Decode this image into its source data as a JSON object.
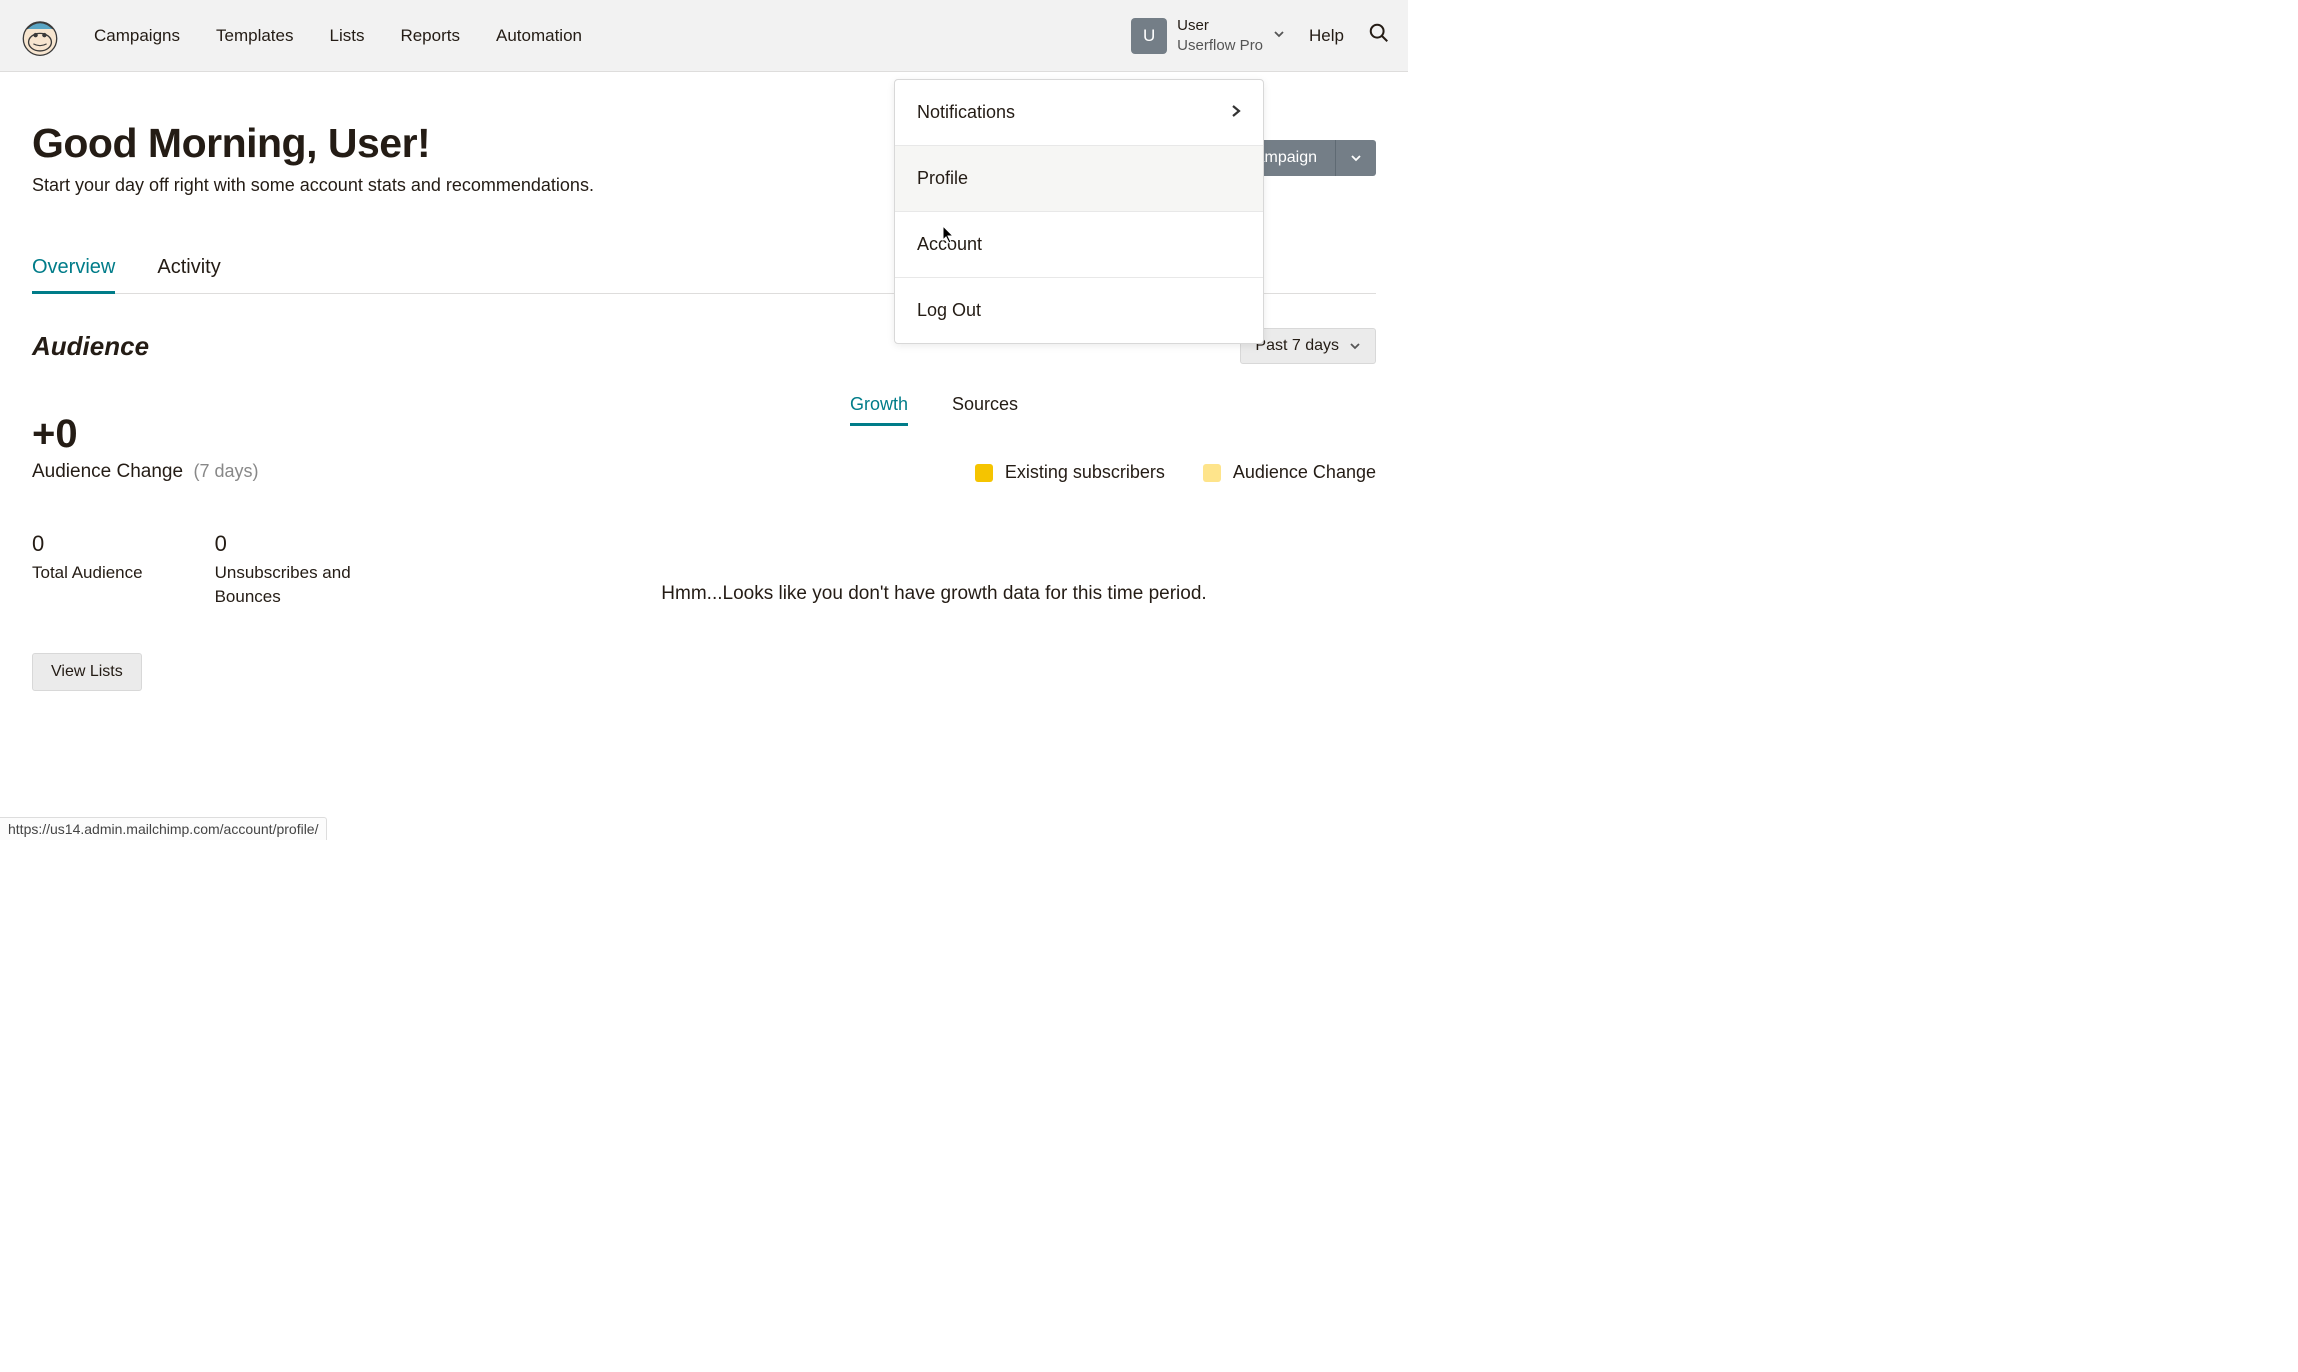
{
  "header": {
    "nav": [
      "Campaigns",
      "Templates",
      "Lists",
      "Reports",
      "Automation"
    ],
    "user_badge": "U",
    "user_name": "User",
    "user_org": "Userflow Pro",
    "help": "Help"
  },
  "dropdown": {
    "notifications": "Notifications",
    "profile": "Profile",
    "account": "Account",
    "logout": "Log Out"
  },
  "main": {
    "greeting": "Good Morning, User!",
    "subgreeting": "Start your day off right with some account stats and recommendations.",
    "campaign_btn": "Create Campaign"
  },
  "tabs": {
    "overview": "Overview",
    "activity": "Activity"
  },
  "audience": {
    "title": "Audience",
    "timerange": "Past 7 days",
    "big_stat": "+0",
    "change_label": "Audience Change",
    "change_period": "(7 days)",
    "total_val": "0",
    "total_label": "Total Audience",
    "unsub_val": "0",
    "unsub_label": "Unsubscribes and Bounces",
    "view_lists": "View Lists"
  },
  "chart": {
    "tabs": {
      "growth": "Growth",
      "sources": "Sources"
    },
    "legend": {
      "existing": "Existing subscribers",
      "change": "Audience Change"
    },
    "empty": "Hmm...Looks like you don't have growth data for this time period."
  },
  "status_url": "https://us14.admin.mailchimp.com/account/profile/",
  "chart_data": {
    "type": "bar",
    "categories": [],
    "series": [
      {
        "name": "Existing subscribers",
        "values": []
      },
      {
        "name": "Audience Change",
        "values": []
      }
    ],
    "title": "Growth",
    "note": "No growth data for this time period"
  }
}
